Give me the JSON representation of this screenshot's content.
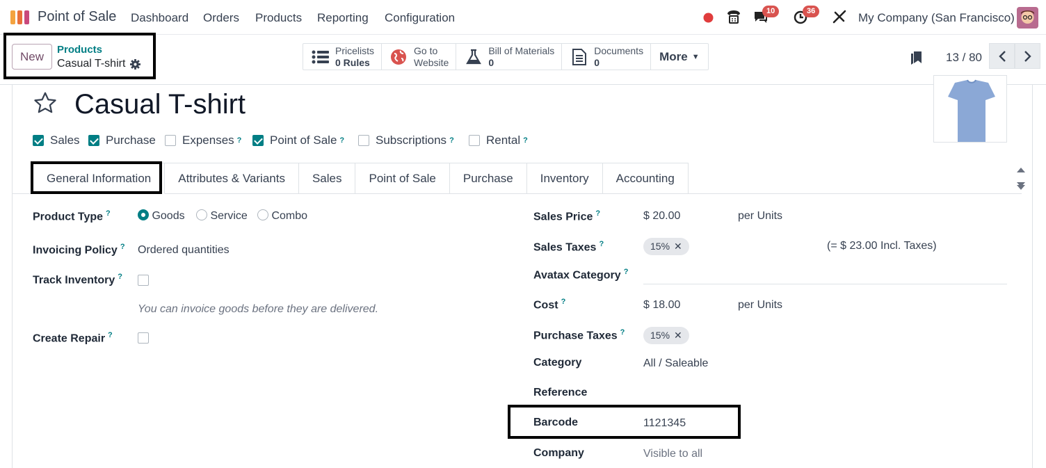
{
  "navbar": {
    "app_name": "Point of Sale",
    "menu": [
      "Dashboard",
      "Orders",
      "Products",
      "Reporting",
      "Configuration"
    ],
    "messages_count": "10",
    "activities_count": "36",
    "company": "My Company (San Francisco)",
    "colors": {
      "accent": "#714b67",
      "badge": "#d9534f",
      "status_dot": "#e03c3c"
    }
  },
  "control": {
    "new_label": "New",
    "breadcrumb_parent": "Products",
    "breadcrumb_current": "Casual T-shirt",
    "smart_buttons": [
      {
        "icon": "list-icon",
        "line1": "Pricelists",
        "line2": "0 Rules"
      },
      {
        "icon": "globe-icon",
        "line1": "Go to",
        "line2": "Website"
      },
      {
        "icon": "flask-icon",
        "line1": "Bill of Materials",
        "line2": "0"
      },
      {
        "icon": "document-icon",
        "line1": "Documents",
        "line2": "0"
      }
    ],
    "more_label": "More",
    "pager": "13 / 80"
  },
  "product": {
    "name": "Casual T-shirt",
    "flags": [
      {
        "label": "Sales",
        "checked": true,
        "help": false
      },
      {
        "label": "Purchase",
        "checked": true,
        "help": false
      },
      {
        "label": "Expenses",
        "checked": false,
        "help": true
      },
      {
        "label": "Point of Sale",
        "checked": true,
        "help": true
      },
      {
        "label": "Subscriptions",
        "checked": false,
        "help": true
      },
      {
        "label": "Rental",
        "checked": false,
        "help": true
      }
    ]
  },
  "tabs": [
    "General Information",
    "Attributes & Variants",
    "Sales",
    "Point of Sale",
    "Purchase",
    "Inventory",
    "Accounting"
  ],
  "left": {
    "product_type_label": "Product Type",
    "product_type_options": [
      "Goods",
      "Service",
      "Combo"
    ],
    "invoicing_policy_label": "Invoicing Policy",
    "invoicing_policy_value": "Ordered quantities",
    "track_inventory_label": "Track Inventory",
    "hint": "You can invoice goods before they are delivered.",
    "create_repair_label": "Create Repair",
    "help_mark": "?"
  },
  "right": {
    "sales_price_label": "Sales Price",
    "sales_price_value": "$ 20.00",
    "sales_price_unit": "per Units",
    "sales_taxes_label": "Sales Taxes",
    "sales_tax_tag": "15%",
    "incl_taxes": "(= $ 23.00 Incl. Taxes)",
    "avatax_label": "Avatax Category",
    "cost_label": "Cost",
    "cost_value": "$ 18.00",
    "cost_unit": "per Units",
    "purchase_taxes_label": "Purchase Taxes",
    "purchase_tax_tag": "15%",
    "category_label": "Category",
    "category_value": "All / Saleable",
    "reference_label": "Reference",
    "barcode_label": "Barcode",
    "barcode_value": "1121345",
    "company_label": "Company",
    "company_placeholder": "Visible to all"
  }
}
